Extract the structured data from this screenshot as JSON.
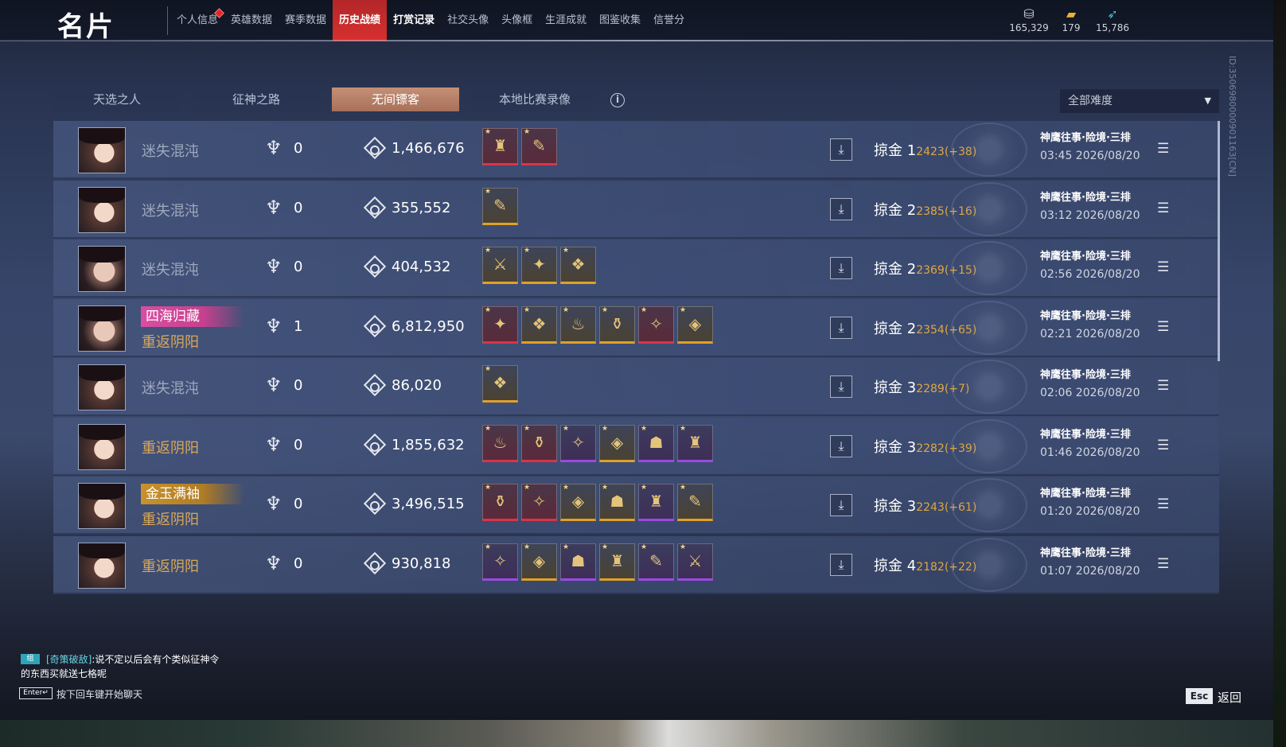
{
  "header": {
    "title": "名片",
    "nav": [
      "个人信息",
      "英雄数据",
      "赛季数据",
      "历史战绩",
      "打赏记录",
      "社交头像",
      "头像框",
      "生涯成就",
      "图鉴收集",
      "信誉分"
    ],
    "active_nav": "历史战绩",
    "currencies": [
      {
        "icon": "coin-stack-icon",
        "value": "165,329"
      },
      {
        "icon": "gold-ticket-icon",
        "value": "179"
      },
      {
        "icon": "feather-icon",
        "value": "15,786"
      }
    ]
  },
  "side_id": "ID:3506980000901163[CN]",
  "tabs": [
    "天选之人",
    "征神之路",
    "无间镖客",
    "本地比赛录像"
  ],
  "active_tab": "无间镖客",
  "difficulty": {
    "selected": "全部难度"
  },
  "rows": [
    {
      "name": "迷失混沌",
      "title": "",
      "kills": "0",
      "value": "1,466,676",
      "items": [
        "red",
        "red"
      ],
      "rank_label": "掠金 1",
      "rank_pts": "2423(+38)",
      "mode": "神鹰往事·险境·三排",
      "time": "03:45  2026/08/20"
    },
    {
      "name": "迷失混沌",
      "title": "",
      "kills": "0",
      "value": "355,552",
      "items": [
        "gold"
      ],
      "rank_label": "掠金 2",
      "rank_pts": "2385(+16)",
      "mode": "神鹰往事·险境·三排",
      "time": "03:12  2026/08/20"
    },
    {
      "name": "迷失混沌",
      "title": "",
      "kills": "0",
      "value": "404,532",
      "items": [
        "gold",
        "gold",
        "gold"
      ],
      "rank_label": "掠金 2",
      "rank_pts": "2369(+15)",
      "mode": "神鹰往事·险境·三排",
      "time": "02:56  2026/08/20"
    },
    {
      "name": "重返阴阳",
      "title": "四海归藏",
      "title_style": "pink",
      "kills": "1",
      "value": "6,812,950",
      "items": [
        "red",
        "gold",
        "gold",
        "gold",
        "red",
        "gold"
      ],
      "rank_label": "掠金 2",
      "rank_pts": "2354(+65)",
      "mode": "神鹰往事·险境·三排",
      "time": "02:21  2026/08/20"
    },
    {
      "name": "迷失混沌",
      "title": "",
      "kills": "0",
      "value": "86,020",
      "items": [
        "gold"
      ],
      "rank_label": "掠金 3",
      "rank_pts": "2289(+7)",
      "mode": "神鹰往事·险境·三排",
      "time": "02:06  2026/08/20"
    },
    {
      "name": "重返阴阳",
      "title": "",
      "kills": "0",
      "value": "1,855,632",
      "items": [
        "red",
        "red",
        "purple",
        "gold",
        "purple",
        "purple"
      ],
      "rank_label": "掠金 3",
      "rank_pts": "2282(+39)",
      "mode": "神鹰往事·险境·三排",
      "time": "01:46  2026/08/20"
    },
    {
      "name": "重返阴阳",
      "title": "金玉满袖",
      "title_style": "gold",
      "kills": "0",
      "value": "3,496,515",
      "items": [
        "red",
        "red",
        "gold",
        "gold",
        "purple",
        "gold"
      ],
      "rank_label": "掠金 3",
      "rank_pts": "2243(+61)",
      "mode": "神鹰往事·险境·三排",
      "time": "01:20  2026/08/20"
    },
    {
      "name": "重返阴阳",
      "title": "",
      "kills": "0",
      "value": "930,818",
      "items": [
        "purple",
        "gold",
        "purple",
        "gold",
        "purple",
        "purple"
      ],
      "rank_label": "掠金 4",
      "rank_pts": "2182(+22)",
      "mode": "神鹰往事·险境·三排",
      "time": "01:07  2026/08/20"
    }
  ],
  "chat": {
    "channel_tag": "组",
    "sender": "[奇策破敌]",
    "message_1": ":说不定以后会有个类似征神令",
    "message_2": "的东西买就送七格呢",
    "enter_key": "Enter↵",
    "enter_hint": "按下回车键开始聊天"
  },
  "footer": {
    "esc_key": "Esc",
    "back_label": "返回"
  },
  "colors": {
    "accent_red": "#d8302e",
    "tab_active": "#b8806a",
    "rank_points": "#e0a840",
    "name_orange": "#d8a85a"
  }
}
